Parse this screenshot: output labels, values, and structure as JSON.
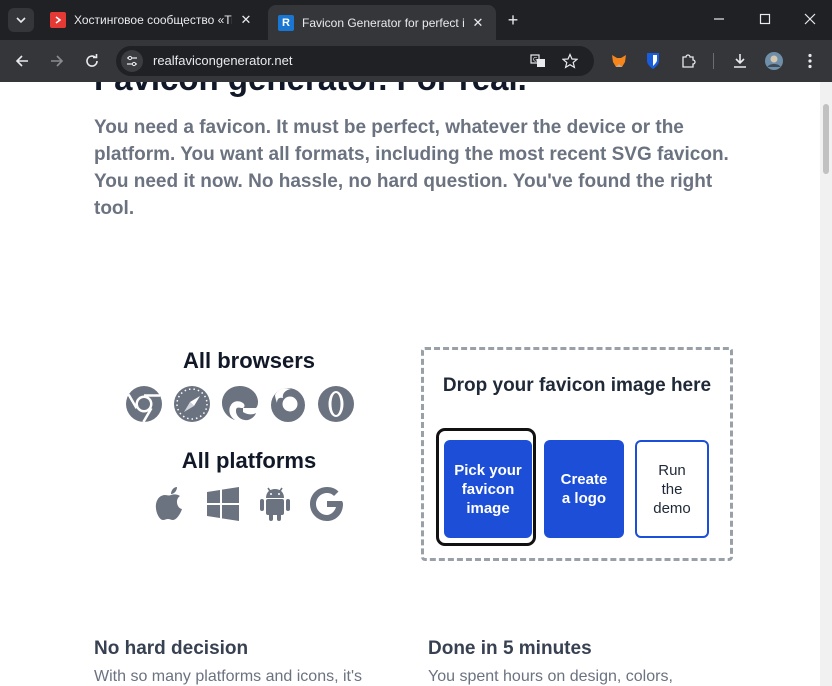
{
  "browser": {
    "tabs": [
      {
        "title": "Хостинговое сообщество «Timeweb»",
        "favicon_color": "#e53935",
        "active": false
      },
      {
        "title": "Favicon Generator for perfect icons",
        "favicon_color": "#1976d2",
        "favicon_letter": "R",
        "active": true
      }
    ],
    "new_tab_label": "+",
    "url": "realfavicongenerator.net"
  },
  "page": {
    "headline": "Favicon generator. For real.",
    "lead": "You need a favicon. It must be perfect, whatever the device or the platform. You want all formats, including the most recent SVG favicon. You need it now. No hassle, no hard question. You've found the right tool.",
    "browsers_title": "All browsers",
    "browser_icons": [
      "chrome-icon",
      "safari-icon",
      "edge-icon",
      "firefox-icon",
      "opera-icon"
    ],
    "platforms_title": "All platforms",
    "platform_icons": [
      "apple-icon",
      "windows-icon",
      "android-icon",
      "google-icon"
    ],
    "dropzone": {
      "text": "Drop your favicon image here",
      "pick_button": "Pick your favicon image",
      "logo_button": "Create a logo",
      "demo_button": "Run the demo"
    },
    "features": [
      {
        "title": "No hard decision",
        "text": "With so many platforms and icons, it's"
      },
      {
        "title": "Done in 5 minutes",
        "text": "You spent hours on design, colors,"
      }
    ]
  },
  "colors": {
    "accent": "#1d4ed8",
    "icon_gray": "#6b7280",
    "chrome_dark": "#202124",
    "chrome_toolbar": "#35363a"
  }
}
